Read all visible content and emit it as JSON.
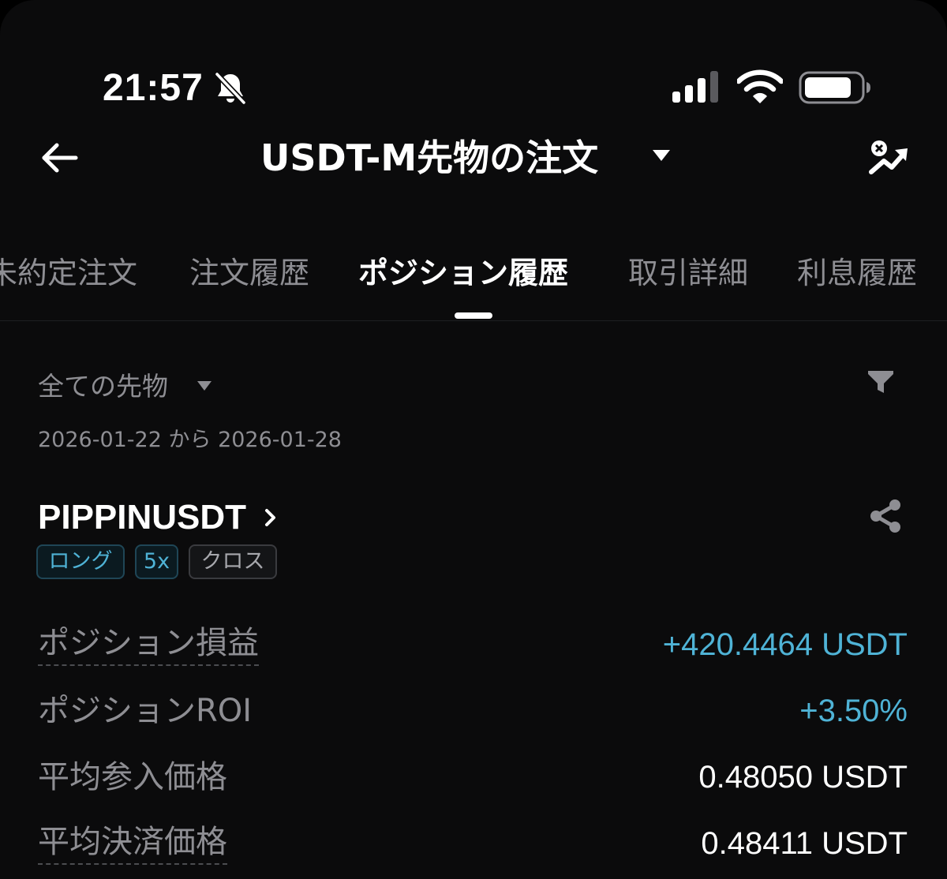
{
  "colors": {
    "background": "#0b0b0c",
    "text_primary": "#ffffff",
    "text_secondary": "#8e8e93",
    "accent_positive": "#4fb3d6"
  },
  "status_bar": {
    "time": "21:57",
    "icons": [
      "bell-off-icon",
      "signal-icon",
      "wifi-icon",
      "battery-icon"
    ]
  },
  "header": {
    "title": "USDT-M先物の注文",
    "left_icon": "back-arrow-icon",
    "right_icon": "pnl-analysis-icon"
  },
  "tabs": [
    {
      "label": "未約定注文",
      "active": false
    },
    {
      "label": "注文履歴",
      "active": false
    },
    {
      "label": "ポジション履歴",
      "active": true
    },
    {
      "label": "取引詳細",
      "active": false
    },
    {
      "label": "利息履歴",
      "active": false
    }
  ],
  "filter": {
    "selected": "全ての先物",
    "date_range": "2026-01-22 から 2026-01-28"
  },
  "position": {
    "symbol": "PIPPINUSDT",
    "tags": [
      "ロング",
      "5x",
      "クロス"
    ],
    "rows": [
      {
        "label": "ポジション損益",
        "value": "+420.4464 USDT"
      },
      {
        "label": "ポジションROI",
        "value": "+3.50%"
      },
      {
        "label": "平均参入価格",
        "value": "0.48050 USDT"
      },
      {
        "label": "平均決済価格",
        "value": "0.48411 USDT"
      }
    ]
  }
}
